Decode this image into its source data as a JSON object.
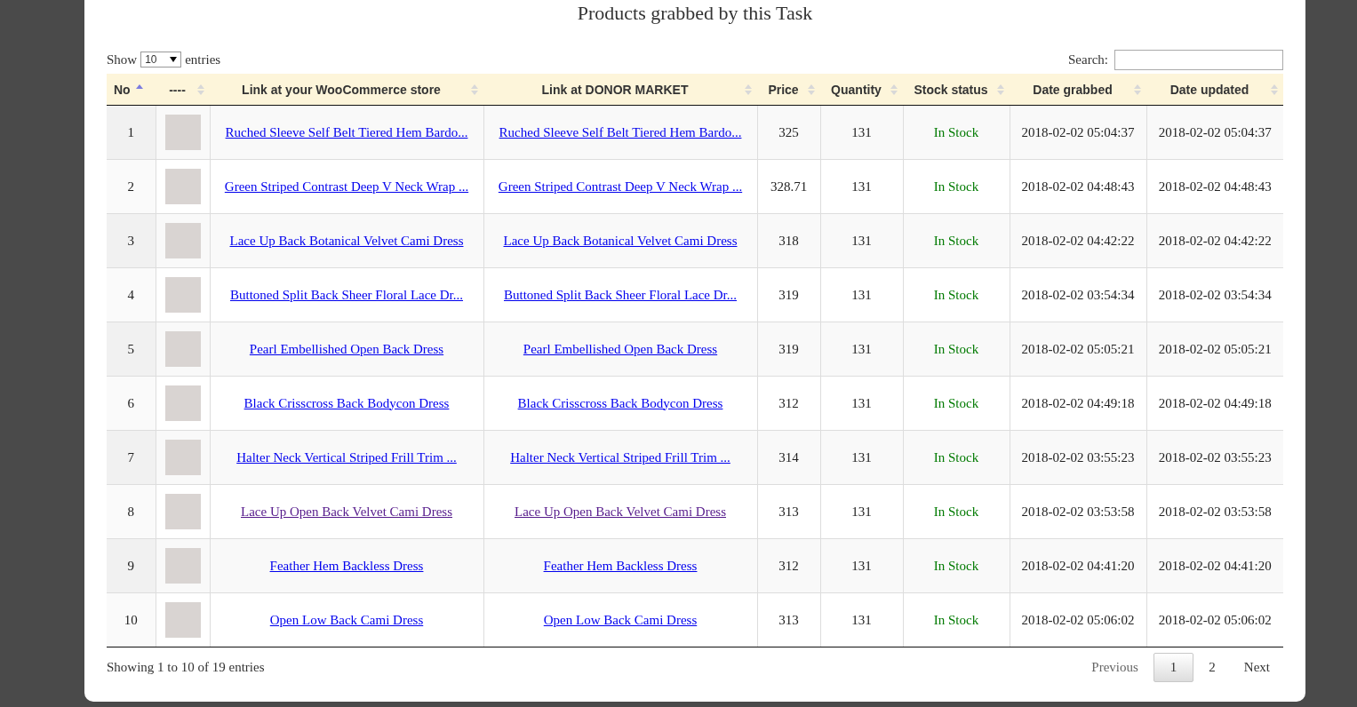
{
  "title": "Products grabbed by this Task",
  "length_menu": {
    "label_before": "Show",
    "value": "10",
    "label_after": "entries"
  },
  "search": {
    "label": "Search:"
  },
  "table": {
    "columns": [
      {
        "label": "No",
        "sorted_ascending": true
      },
      {
        "label": "----",
        "sorted_ascending": false
      },
      {
        "label": "Link at your WooCommerce store",
        "sorted_ascending": false
      },
      {
        "label": "Link at DONOR MARKET",
        "sorted_ascending": false
      },
      {
        "label": "Price",
        "sorted_ascending": false
      },
      {
        "label": "Quantity",
        "sorted_ascending": false
      },
      {
        "label": "Stock status",
        "sorted_ascending": false
      },
      {
        "label": "Date grabbed",
        "sorted_ascending": false
      },
      {
        "label": "Date updated",
        "sorted_ascending": false
      }
    ],
    "rows": [
      {
        "no": "1",
        "store_link": "Ruched Sleeve Self Belt Tiered Hem Bardo...",
        "donor_link": "Ruched Sleeve Self Belt Tiered Hem Bardo...",
        "visited": false,
        "price": "325",
        "quantity": "131",
        "stock": "In Stock",
        "date_grabbed": "2018-02-02 05:04:37",
        "date_updated": "2018-02-02 05:04:37"
      },
      {
        "no": "2",
        "store_link": "Green Striped Contrast Deep V Neck Wrap ...",
        "donor_link": "Green Striped Contrast Deep V Neck Wrap ...",
        "visited": false,
        "price": "328.71",
        "quantity": "131",
        "stock": "In Stock",
        "date_grabbed": "2018-02-02 04:48:43",
        "date_updated": "2018-02-02 04:48:43"
      },
      {
        "no": "3",
        "store_link": "Lace Up Back Botanical Velvet Cami Dress",
        "donor_link": "Lace Up Back Botanical Velvet Cami Dress",
        "visited": false,
        "price": "318",
        "quantity": "131",
        "stock": "In Stock",
        "date_grabbed": "2018-02-02 04:42:22",
        "date_updated": "2018-02-02 04:42:22"
      },
      {
        "no": "4",
        "store_link": "Buttoned Split Back Sheer Floral Lace Dr...",
        "donor_link": "Buttoned Split Back Sheer Floral Lace Dr...",
        "visited": false,
        "price": "319",
        "quantity": "131",
        "stock": "In Stock",
        "date_grabbed": "2018-02-02 03:54:34",
        "date_updated": "2018-02-02 03:54:34"
      },
      {
        "no": "5",
        "store_link": "Pearl Embellished Open Back Dress",
        "donor_link": "Pearl Embellished Open Back Dress",
        "visited": false,
        "price": "319",
        "quantity": "131",
        "stock": "In Stock",
        "date_grabbed": "2018-02-02 05:05:21",
        "date_updated": "2018-02-02 05:05:21"
      },
      {
        "no": "6",
        "store_link": "Black Crisscross Back Bodycon Dress",
        "donor_link": "Black Crisscross Back Bodycon Dress",
        "visited": false,
        "price": "312",
        "quantity": "131",
        "stock": "In Stock",
        "date_grabbed": "2018-02-02 04:49:18",
        "date_updated": "2018-02-02 04:49:18"
      },
      {
        "no": "7",
        "store_link": "Halter Neck Vertical Striped Frill Trim ...",
        "donor_link": "Halter Neck Vertical Striped Frill Trim ...",
        "visited": false,
        "price": "314",
        "quantity": "131",
        "stock": "In Stock",
        "date_grabbed": "2018-02-02 03:55:23",
        "date_updated": "2018-02-02 03:55:23"
      },
      {
        "no": "8",
        "store_link": "Lace Up Open Back Velvet Cami Dress",
        "donor_link": "Lace Up Open Back Velvet Cami Dress",
        "visited": true,
        "price": "313",
        "quantity": "131",
        "stock": "In Stock",
        "date_grabbed": "2018-02-02 03:53:58",
        "date_updated": "2018-02-02 03:53:58"
      },
      {
        "no": "9",
        "store_link": "Feather Hem Backless Dress",
        "donor_link": "Feather Hem Backless Dress",
        "visited": false,
        "price": "312",
        "quantity": "131",
        "stock": "In Stock",
        "date_grabbed": "2018-02-02 04:41:20",
        "date_updated": "2018-02-02 04:41:20"
      },
      {
        "no": "10",
        "store_link": "Open Low Back Cami Dress",
        "donor_link": "Open Low Back Cami Dress",
        "visited": false,
        "price": "313",
        "quantity": "131",
        "stock": "In Stock",
        "date_grabbed": "2018-02-02 05:06:02",
        "date_updated": "2018-02-02 05:06:02"
      }
    ]
  },
  "info": "Showing 1 to 10 of 19 entries",
  "pagination": [
    {
      "label": "Previous",
      "kind": "prev",
      "selected": false
    },
    {
      "label": "1",
      "kind": "page",
      "selected": true
    },
    {
      "label": "2",
      "kind": "page",
      "selected": false
    },
    {
      "label": "Next",
      "kind": "next",
      "selected": false
    }
  ]
}
